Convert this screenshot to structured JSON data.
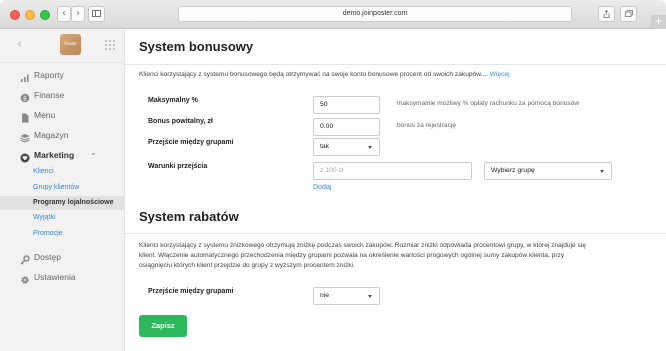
{
  "browser": {
    "url": "demo.joinposter.com",
    "plus": "+"
  },
  "sidebar": {
    "logo_text": "Poster",
    "items": [
      {
        "label": "Raporty",
        "icon": "bar-chart-icon"
      },
      {
        "label": "Finanse",
        "icon": "coin-icon"
      },
      {
        "label": "Menu",
        "icon": "file-icon"
      },
      {
        "label": "Magazyn",
        "icon": "stack-icon"
      },
      {
        "label": "Marketing",
        "icon": "heart-icon"
      },
      {
        "label": "Dostęp",
        "icon": "key-icon"
      },
      {
        "label": "Ustawienia",
        "icon": "gear-icon"
      }
    ],
    "marketing_chevron": "⌄",
    "marketing_sub": [
      {
        "label": "Klienci"
      },
      {
        "label": "Grupy klientów"
      },
      {
        "label": "Programy lojalnościowe"
      },
      {
        "label": "Wyjątki"
      },
      {
        "label": "Promocje"
      }
    ]
  },
  "bonus": {
    "title": "System bonusowy",
    "description": "Klienci korzystający z systemu bonusowego będą otrzymywać na swoje konto bonusowe procent od swoich zakupów....",
    "more_link": "Więcej",
    "max_label": "Maksymalny %",
    "max_value": "50",
    "max_hint": "maksymalnie możliwy % opłaty rachunku za pomocą bonusów",
    "welcome_label": "Bonus powitalny, zł",
    "welcome_value": "0.00",
    "welcome_hint": "bonus za rejestrację",
    "transition_label": "Przejście między grupami",
    "transition_value": "tak",
    "conditions_label": "Warunki przejścia",
    "conditions_placeholder": "z 100 zł",
    "group_select": "Wybierz grupę",
    "add_link": "Dodaj"
  },
  "discount": {
    "title": "System rabatów",
    "description_lines": [
      "Klienci korzystający z systemu zniżkowego otrzymują zniżkę podczas swoich zakupów. Rozmiar zniżki odpowiada procentowi grupy, w której znajduje się",
      "klient. Włączenie automatycznego przechodzenia między grupami pozwala na określenie wartości progowych ogólnej sumy zakupów klienta, przy",
      "osiągnięciu których klient przejdzie do grupy z wyższym procentem zniżki."
    ],
    "transition_label": "Przejście między grupami",
    "transition_value": "nie"
  },
  "save_label": "Zapisz",
  "colors": {
    "accent_link": "#3a87d6",
    "save_button": "#2eb85c"
  }
}
